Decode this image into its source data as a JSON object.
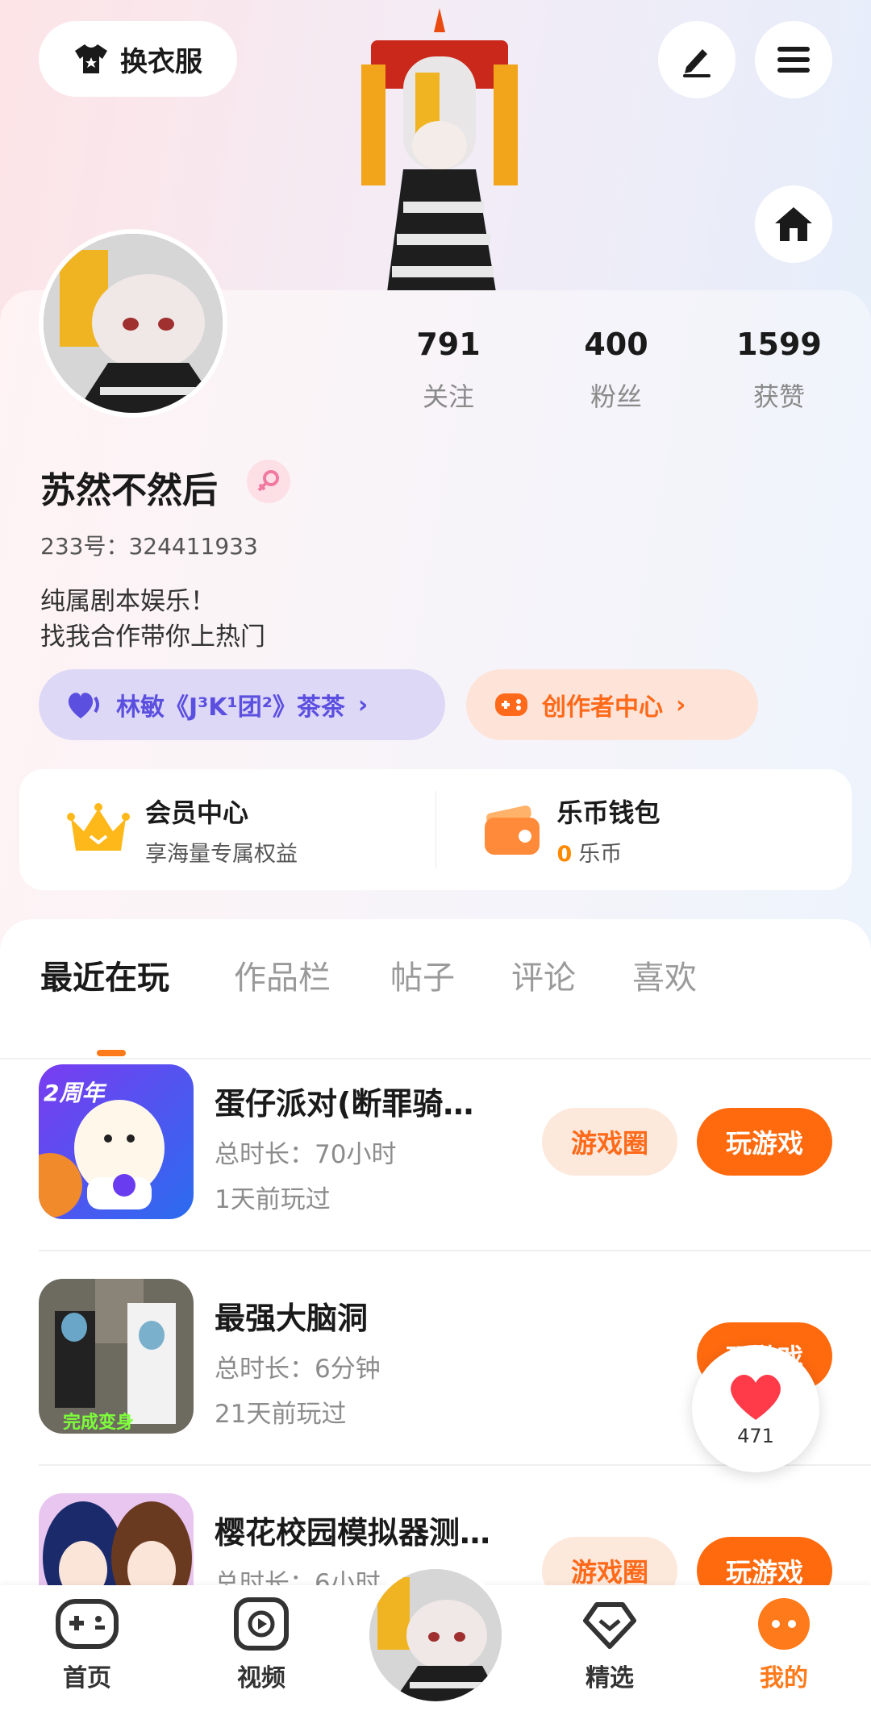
{
  "header": {
    "outfit_label": "换衣服"
  },
  "stats": [
    {
      "value": "791",
      "label": "关注"
    },
    {
      "value": "400",
      "label": "粉丝"
    },
    {
      "value": "1599",
      "label": "获赞"
    }
  ],
  "profile": {
    "nickname": "苏然不然后",
    "uid": "233号：324411933",
    "bio_line1": "纯属剧本娱乐！",
    "bio_line2": "找我合作带你上热门"
  },
  "pills": {
    "team_label": "林敏《J³K¹团²》茶茶",
    "creator_label": "创作者中心"
  },
  "member_card": {
    "vip_title": "会员中心",
    "vip_sub": "享海量专属权益",
    "wallet_title": "乐币钱包",
    "wallet_amount": "0",
    "wallet_unit": "乐币"
  },
  "tabs": [
    "最近在玩",
    "作品栏",
    "帖子",
    "评论",
    "喜欢"
  ],
  "games": [
    {
      "title": "蛋仔派对(断罪骑…",
      "duration": "总时长：70小时",
      "last_played": "1天前玩过",
      "circle_label": "游戏圈",
      "play_label": "玩游戏"
    },
    {
      "title": "最强大脑洞",
      "duration": "总时长：6分钟",
      "last_played": "21天前玩过",
      "circle_label": "",
      "play_label": "玩游戏"
    },
    {
      "title": "樱花校园模拟器测…",
      "duration": "总时长：6小时",
      "last_played": "",
      "circle_label": "游戏圈",
      "play_label": "玩游戏"
    }
  ],
  "game_icon_texts": {
    "anniversary": "2周年",
    "transform": "完成变身"
  },
  "like_float": {
    "count": "471"
  },
  "bottom_nav": [
    {
      "label": "首页"
    },
    {
      "label": "视频"
    },
    {
      "label": "精选"
    },
    {
      "label": "我的"
    }
  ],
  "colors": {
    "accent": "#ff6a0f",
    "team_purple": "#5b4fe0"
  }
}
